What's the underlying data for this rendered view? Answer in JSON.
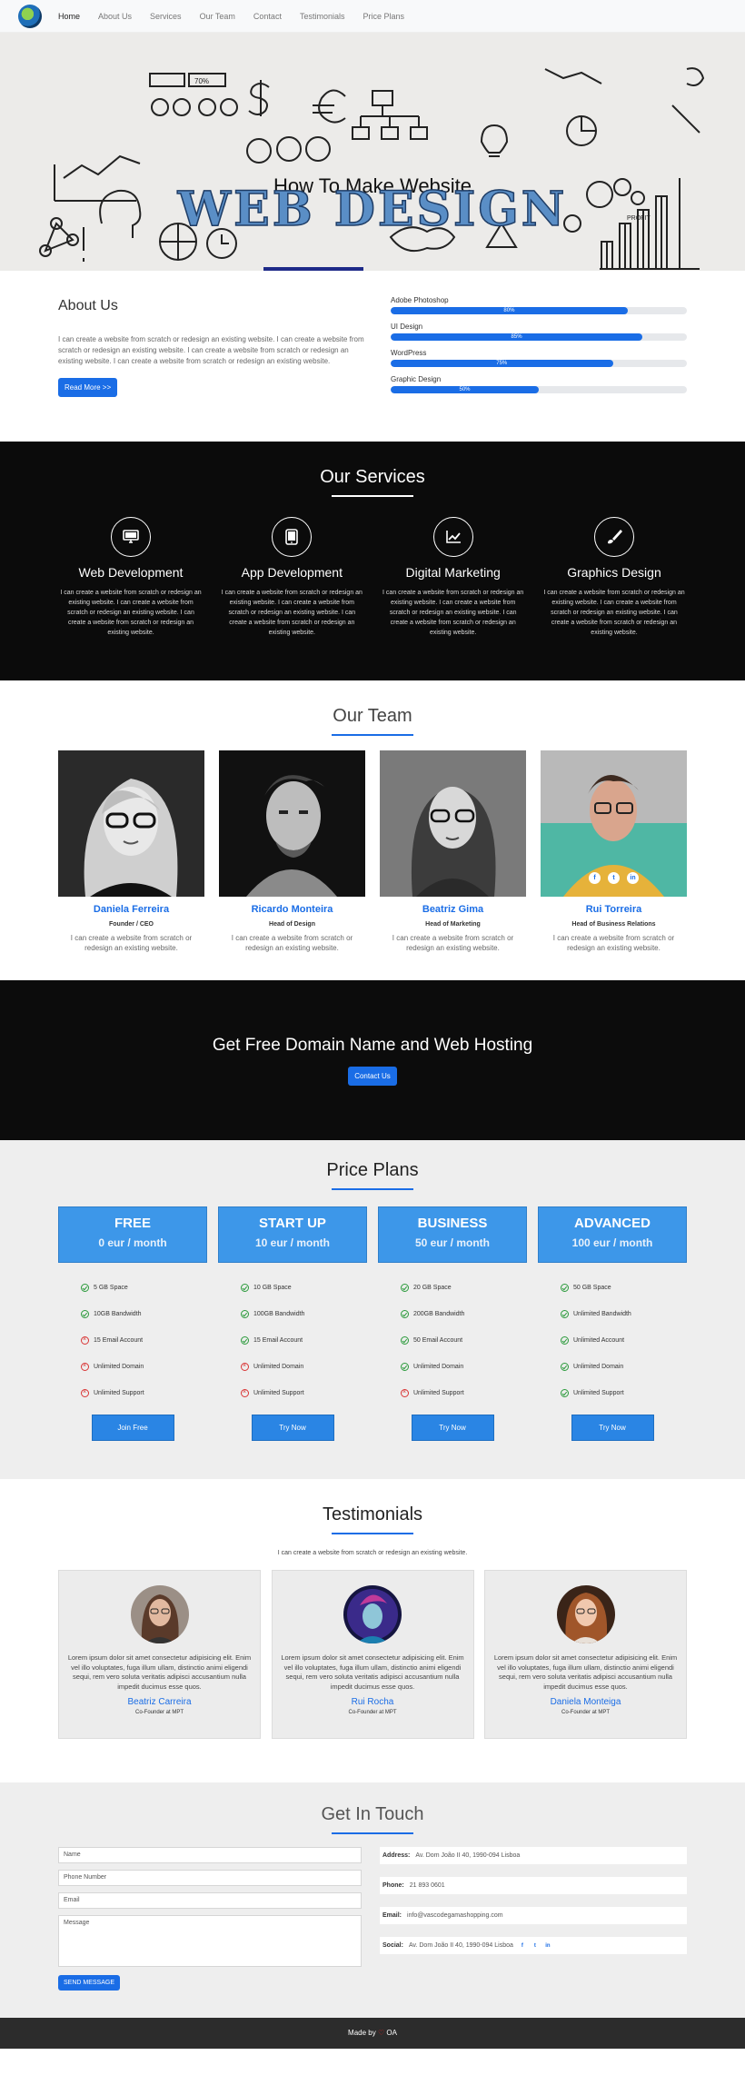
{
  "nav": {
    "links": [
      "Home",
      "About Us",
      "Services",
      "Our Team",
      "Contact",
      "Testimonials",
      "Price Plans"
    ]
  },
  "hero": {
    "small_title": "How To Make Website",
    "big_title": "WEB DESIGN",
    "sketch_labels": [
      "70%",
      "PROFIT"
    ]
  },
  "about": {
    "title": "About Us",
    "text": "I can create a website from scratch or redesign an existing website. I can create a website from scratch or redesign an existing website. I can create a website from scratch or redesign an existing website. I can create a website from scratch or redesign an existing website.",
    "button": "Read More >>",
    "skills": [
      {
        "name": "Adobe Photoshop",
        "label": "80%",
        "value": 0.8
      },
      {
        "name": "UI Design",
        "label": "85%",
        "value": 0.85
      },
      {
        "name": "WordPress",
        "label": "75%",
        "value": 0.75
      },
      {
        "name": "Graphic Design",
        "label": "50%",
        "value": 0.5
      }
    ]
  },
  "services": {
    "title": "Our Services",
    "items": [
      {
        "icon": "monitor-icon",
        "title": "Web Development",
        "text": "I can create a website from scratch or redesign an existing website. I can create a website from scratch or redesign an existing website. I can create a website from scratch or redesign an existing website."
      },
      {
        "icon": "tablet-icon",
        "title": "App Development",
        "text": "I can create a website from scratch or redesign an existing website. I can create a website from scratch or redesign an existing website. I can create a website from scratch or redesign an existing website."
      },
      {
        "icon": "chart-line-icon",
        "title": "Digital Marketing",
        "text": "I can create a website from scratch or redesign an existing website. I can create a website from scratch or redesign an existing website. I can create a website from scratch or redesign an existing website."
      },
      {
        "icon": "brush-icon",
        "title": "Graphics Design",
        "text": "I can create a website from scratch or redesign an existing website. I can create a website from scratch or redesign an existing website. I can create a website from scratch or redesign an existing website."
      }
    ]
  },
  "team": {
    "title": "Our Team",
    "members": [
      {
        "name": "Daniela Ferreira",
        "role": "Founder / CEO",
        "text": "I can create a website from scratch or redesign an existing website."
      },
      {
        "name": "Ricardo Monteira",
        "role": "Head of Design",
        "text": "I can create a website from scratch or redesign an existing website."
      },
      {
        "name": "Beatriz Gima",
        "role": "Head of Marketing",
        "text": "I can create a website from scratch or redesign an existing website."
      },
      {
        "name": "Rui Torreira",
        "role": "Head of Business Relations",
        "text": "I can create a website from scratch or redesign an existing website."
      }
    ],
    "social_icons": [
      "facebook-icon",
      "twitter-icon",
      "linkedin-icon"
    ]
  },
  "cta": {
    "title": "Get Free Domain Name and Web Hosting",
    "button": "Contact Us"
  },
  "pricing": {
    "title": "Price Plans",
    "plans": [
      {
        "name": "FREE",
        "price": "0 eur / month",
        "button": "Join Free",
        "features": [
          {
            "text": "5 GB Space",
            "included": true
          },
          {
            "text": "10GB Bandwidth",
            "included": true
          },
          {
            "text": "15 Email Account",
            "included": false
          },
          {
            "text": "Unlimited Domain",
            "included": false
          },
          {
            "text": "Unlimited Support",
            "included": false
          }
        ]
      },
      {
        "name": "START UP",
        "price": "10 eur / month",
        "button": "Try Now",
        "features": [
          {
            "text": "10 GB Space",
            "included": true
          },
          {
            "text": "100GB Bandwidth",
            "included": true
          },
          {
            "text": "15 Email Account",
            "included": true
          },
          {
            "text": "Unlimited Domain",
            "included": false
          },
          {
            "text": "Unlimited Support",
            "included": false
          }
        ]
      },
      {
        "name": "BUSINESS",
        "price": "50 eur / month",
        "button": "Try Now",
        "features": [
          {
            "text": "20 GB Space",
            "included": true
          },
          {
            "text": "200GB Bandwidth",
            "included": true
          },
          {
            "text": "50 Email Account",
            "included": true
          },
          {
            "text": "Unlimited Domain",
            "included": true
          },
          {
            "text": "Unlimited Support",
            "included": false
          }
        ]
      },
      {
        "name": "ADVANCED",
        "price": "100 eur / month",
        "button": "Try Now",
        "features": [
          {
            "text": "50 GB Space",
            "included": true
          },
          {
            "text": "Unlimited Bandwidth",
            "included": true
          },
          {
            "text": "Unlimited Account",
            "included": true
          },
          {
            "text": "Unlimited Domain",
            "included": true
          },
          {
            "text": "Unlimited Support",
            "included": true
          }
        ]
      }
    ]
  },
  "testimonials": {
    "title": "Testimonials",
    "subtitle": "I can create a website from scratch or redesign an existing website.",
    "items": [
      {
        "text": "Lorem ipsum dolor sit amet consectetur adipisicing elit. Enim vel illo voluptates, fuga illum ullam, distinctio animi eligendi sequi, rem vero soluta veritatis adipisci accusantium nulla impedit ducimus esse quos.",
        "name": "Beatriz Carreira",
        "position": "Co-Founder at MPT"
      },
      {
        "text": "Lorem ipsum dolor sit amet consectetur adipisicing elit. Enim vel illo voluptates, fuga illum ullam, distinctio animi eligendi sequi, rem vero soluta veritatis adipisci accusantium nulla impedit ducimus esse quos.",
        "name": "Rui Rocha",
        "position": "Co-Founder at MPT"
      },
      {
        "text": "Lorem ipsum dolor sit amet consectetur adipisicing elit. Enim vel illo voluptates, fuga illum ullam, distinctio animi eligendi sequi, rem vero soluta veritatis adipisci accusantium nulla impedit ducimus esse quos.",
        "name": "Daniela Monteiga",
        "position": "Co-Founder at MPT"
      }
    ]
  },
  "contact": {
    "title": "Get In Touch",
    "placeholders": {
      "name": "Name",
      "phone": "Phone Number",
      "email": "Email",
      "message": "Message"
    },
    "button": "SEND MESSAGE",
    "address_label": "Address:",
    "address": "Av. Dom João II 40, 1990-094 Lisboa",
    "phone_label": "Phone:",
    "phone": "21 893 0601",
    "email_label": "Email:",
    "email": "info@vascodegamashopping.com",
    "social_label": "Social:",
    "social": "Av. Dom João II 40, 1990-094 Lisboa"
  },
  "footer": {
    "made_by": "Made by",
    "author": "OA"
  },
  "colors": {
    "accent": "#1a6de6",
    "plan_header": "#3d97e9",
    "dark": "#0b0b0b",
    "light_bg": "#eeeeee"
  }
}
